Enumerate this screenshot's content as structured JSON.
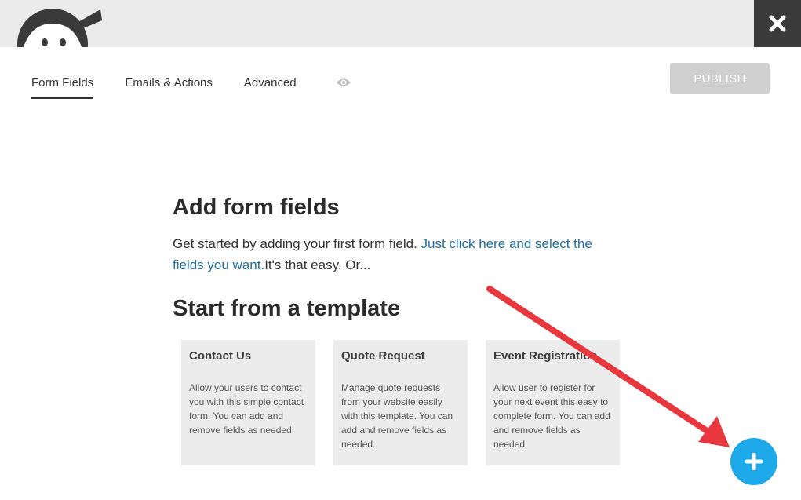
{
  "header": {
    "logo_icon": "ninja-logo-icon",
    "close_icon": "close-icon"
  },
  "tabs": [
    {
      "label": "Form Fields",
      "active": true
    },
    {
      "label": "Emails & Actions",
      "active": false
    },
    {
      "label": "Advanced",
      "active": false
    }
  ],
  "preview_icon": "eye-icon",
  "publish_label": "PUBLISH",
  "main": {
    "heading": "Add form fields",
    "intro_prefix": "Get started by adding your first form field. ",
    "intro_link": "Just click here and select the fields you want.",
    "intro_suffix": "It's that easy. Or...",
    "template_heading": "Start from a template"
  },
  "templates": [
    {
      "title": "Contact Us",
      "description": "Allow your users to contact you with this simple contact form. You can add and remove fields as needed."
    },
    {
      "title": "Quote Request",
      "description": "Manage quote requests from your website easily with this template. You can add and remove fields as needed."
    },
    {
      "title": "Event Registration",
      "description": "Allow user to register for your next event this easy to complete form. You can add and remove fields as needed."
    }
  ],
  "colors": {
    "accent": "#1ea9ea",
    "annotation_arrow": "#e8373f",
    "link": "#1f6f9f",
    "publish_disabled": "#cfcfcf"
  },
  "add_button_icon": "plus-icon"
}
